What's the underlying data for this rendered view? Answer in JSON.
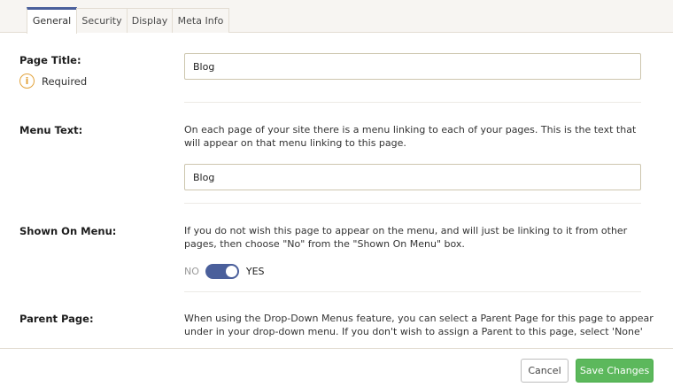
{
  "tabs": [
    {
      "label": "General",
      "active": true
    },
    {
      "label": "Security",
      "active": false
    },
    {
      "label": "Display",
      "active": false
    },
    {
      "label": "Meta Info",
      "active": false
    }
  ],
  "page_title": {
    "label": "Page Title:",
    "required_icon": "info-icon",
    "required_text": "Required",
    "value": "Blog"
  },
  "menu_text": {
    "label": "Menu Text:",
    "description": "On each page of your site there is a menu linking to each of your pages. This is the text that will appear on that menu linking to this page.",
    "value": "Blog"
  },
  "shown_on_menu": {
    "label": "Shown On Menu:",
    "description": "If you do not wish this page to appear on the menu, and will just be linking to it from other pages, then choose \"No\" from the \"Shown On Menu\" box.",
    "off_label": "NO",
    "on_label": "YES",
    "state": "on"
  },
  "parent_page": {
    "label": "Parent Page:",
    "description": "When using the Drop-Down Menus feature, you can select a Parent Page for this page to appear under in your drop-down menu. If you don't wish to assign a Parent to this page, select 'None'"
  },
  "footer": {
    "cancel_label": "Cancel",
    "save_label": "Save Changes"
  },
  "colors": {
    "accent": "#4a5f9b",
    "save": "#5cb85c",
    "required_icon": "#e2a23a"
  }
}
